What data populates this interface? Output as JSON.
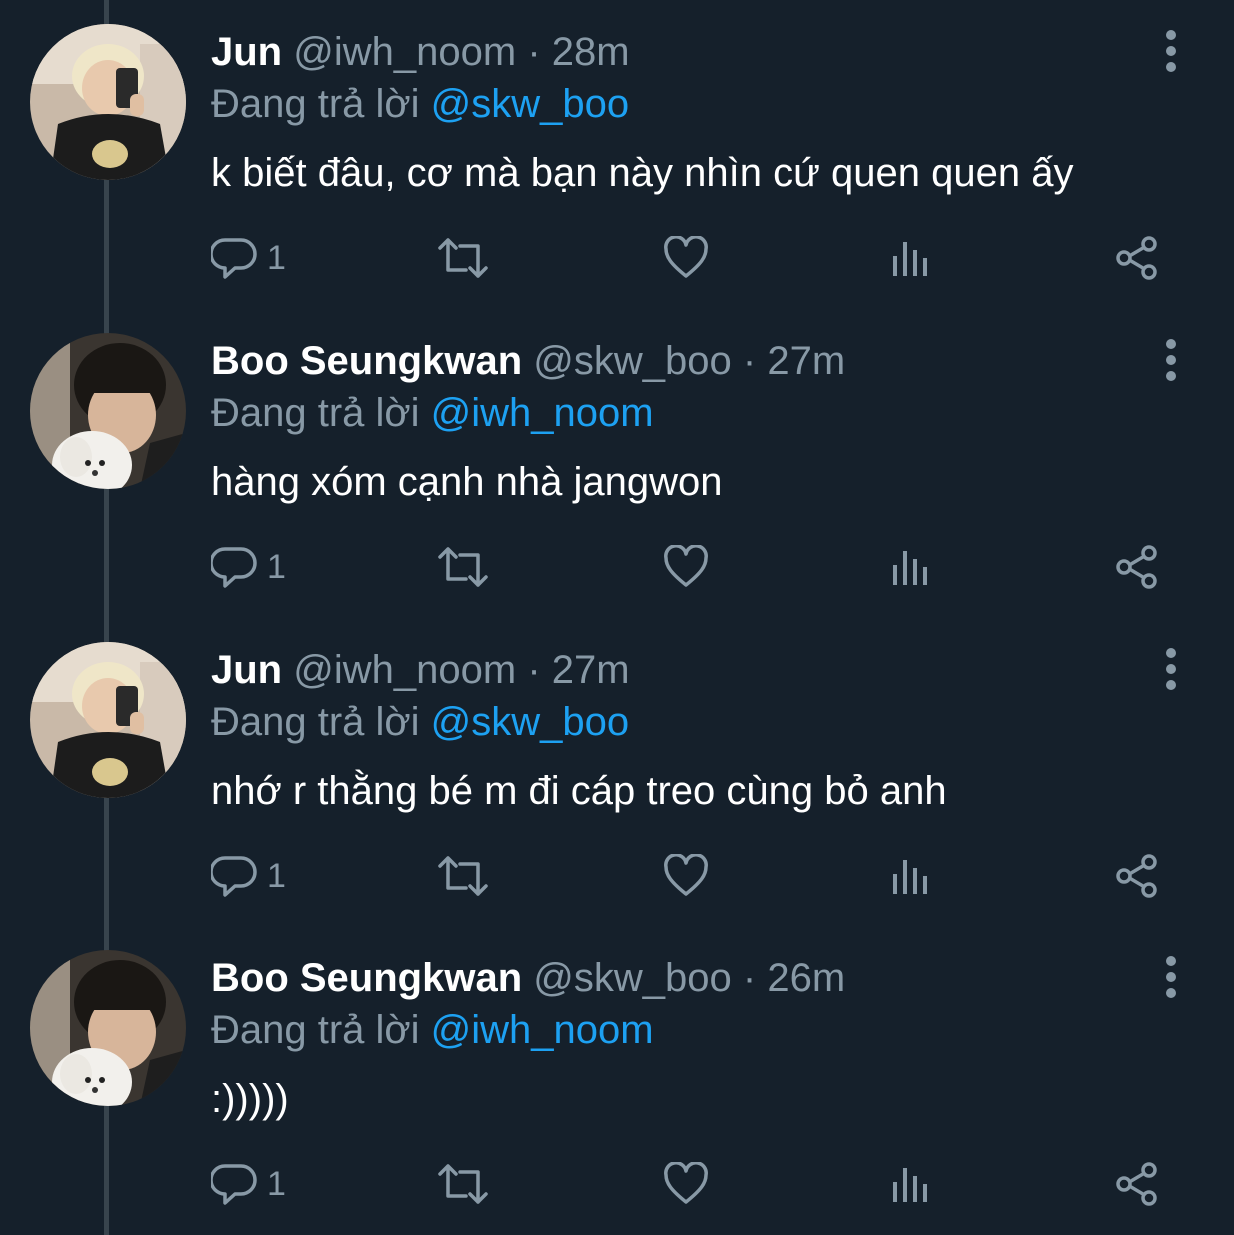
{
  "colors": {
    "background": "#15202b",
    "thread_line": "#38444d",
    "muted_text": "#8899a6",
    "mention": "#1da1f2",
    "primary_text": "#ffffff"
  },
  "tweets": [
    {
      "name": "Jun",
      "handle": "@iwh_noom",
      "separator": "·",
      "time": "28m",
      "reply_prefix": "Đang trả lời",
      "reply_to": "@skw_boo",
      "text": "k biết đâu, cơ mà bạn này nhìn cứ quen quen ấy",
      "reply_count": "1",
      "avatar": "selfie-blond-avatar"
    },
    {
      "name": "Boo Seungkwan",
      "handle": "@skw_boo",
      "separator": "·",
      "time": "27m",
      "reply_prefix": "Đang trả lời",
      "reply_to": "@iwh_noom",
      "text": "hàng xóm cạnh nhà jangwon",
      "reply_count": "1",
      "avatar": "man-with-white-dog-avatar"
    },
    {
      "name": "Jun",
      "handle": "@iwh_noom",
      "separator": "·",
      "time": "27m",
      "reply_prefix": "Đang trả lời",
      "reply_to": "@skw_boo",
      "text": "nhớ r thằng bé m đi cáp treo cùng bỏ anh",
      "reply_count": "1",
      "avatar": "selfie-blond-avatar"
    },
    {
      "name": "Boo Seungkwan",
      "handle": "@skw_boo",
      "separator": "·",
      "time": "26m",
      "reply_prefix": "Đang trả lời",
      "reply_to": "@iwh_noom",
      "text": ":)))))",
      "reply_count": "1",
      "avatar": "man-with-white-dog-avatar"
    }
  ],
  "icons": {
    "reply": "reply-icon",
    "retweet": "retweet-icon",
    "like": "heart-icon",
    "analytics": "analytics-icon",
    "share": "share-icon",
    "more": "more-vertical-icon"
  }
}
